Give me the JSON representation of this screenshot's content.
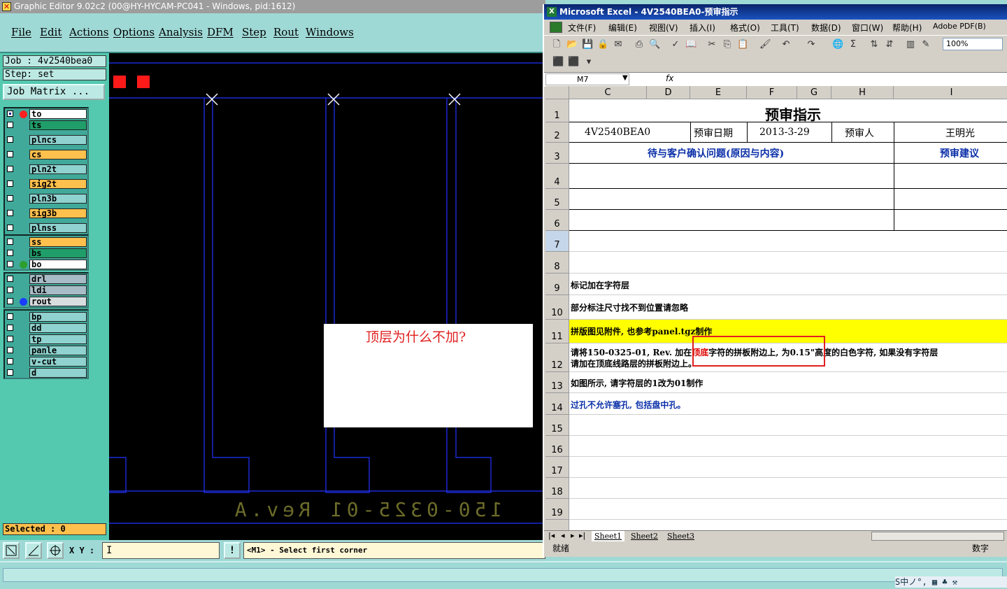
{
  "ge": {
    "title": "Graphic Editor 9.02c2 (00@HY-HYCAM-PC041 - Windows, pid:1612)",
    "menu": [
      "File",
      "Edit",
      "Actions",
      "Options",
      "Analysis",
      "DFM",
      "Step",
      "Rout",
      "Windows"
    ],
    "job_label": "Job : 4v2540bea0",
    "step_label": "Step: set",
    "job_matrix": "Job Matrix ...",
    "layers": [
      {
        "name": "to",
        "color": "#ffffff",
        "dot": "#ff2020",
        "checked": true
      },
      {
        "name": "ts",
        "color": "#1f9e6a",
        "dot": "",
        "checked": false
      },
      {
        "name": "plncs",
        "color": "#8fd2cf",
        "dot": "",
        "checked": false
      },
      {
        "name": "cs",
        "color": "#ffc04d",
        "dot": "",
        "checked": false
      },
      {
        "name": "pln2t",
        "color": "#8fd2cf",
        "dot": "",
        "checked": false
      },
      {
        "name": "sig2t",
        "color": "#ffc04d",
        "dot": "",
        "checked": false
      },
      {
        "name": "pln3b",
        "color": "#8fd2cf",
        "dot": "",
        "checked": false
      },
      {
        "name": "sig3b",
        "color": "#ffc04d",
        "dot": "",
        "checked": false
      },
      {
        "name": "plnss",
        "color": "#8fd2cf",
        "dot": "",
        "checked": false
      },
      {
        "name": "ss",
        "color": "#ffc04d",
        "dot": "",
        "checked": false
      },
      {
        "name": "bs",
        "color": "#1f9e6a",
        "dot": "",
        "checked": false
      },
      {
        "name": "bo",
        "color": "#ffffff",
        "dot": "#2e9e2e",
        "checked": false
      },
      {
        "name": "drl",
        "color": "#a7bcc6",
        "dot": "",
        "checked": false
      },
      {
        "name": "ldi",
        "color": "#a7bcc6",
        "dot": "",
        "checked": false
      },
      {
        "name": "rout",
        "color": "#d8dde0",
        "dot": "#1a3cff",
        "checked": false
      },
      {
        "name": "bp",
        "color": "#8fd2cf",
        "dot": "",
        "checked": false
      },
      {
        "name": "dd",
        "color": "#8fd2cf",
        "dot": "",
        "checked": false
      },
      {
        "name": "tp",
        "color": "#8fd2cf",
        "dot": "",
        "checked": false
      },
      {
        "name": "panle",
        "color": "#8fd2cf",
        "dot": "",
        "checked": false
      },
      {
        "name": "v-cut",
        "color": "#8fd2cf",
        "dot": "",
        "checked": false
      },
      {
        "name": "d",
        "color": "#8fd2cf",
        "dot": "",
        "checked": false
      }
    ],
    "selected": "Selected : 0",
    "xy_label": "X Y :",
    "xy_value": "I",
    "prompt": "<M1> - Select first corner",
    "mirror_text": "150-0325-01 Rev.A",
    "annotation": "顶层为什么不加?"
  },
  "excel": {
    "title": "Microsoft Excel - 4V2540BEA0-预审指示",
    "menu": [
      "文件(F)",
      "编辑(E)",
      "视图(V)",
      "插入(I)",
      "格式(O)",
      "工具(T)",
      "数据(D)",
      "窗口(W)",
      "帮助(H)",
      "Adobe PDF(B)"
    ],
    "zoom": "100%",
    "namebox": "M7",
    "fx": "fx",
    "columns": [
      "C",
      "D",
      "E",
      "F",
      "G",
      "H",
      "I"
    ],
    "rows": [
      "1",
      "2",
      "3",
      "4",
      "5",
      "6",
      "7",
      "8",
      "9",
      "10",
      "11",
      "12",
      "13",
      "14",
      "15",
      "16",
      "17",
      "18",
      "19"
    ],
    "cells": {
      "title": "预审指示",
      "job": "4V2540BEA0",
      "date_label": "预审日期",
      "date": "2013-3-29",
      "reviewer_label": "预审人",
      "reviewer": "王明光",
      "issues_header": "待与客户确认问题(原因与内容)",
      "advice_header": "预审建议",
      "r9": "标记加在字符层",
      "r10": "部分标注尺寸找不到位置请忽略",
      "r11": "拼版图见附件, 也参考panel.tgz制作",
      "r12a_1": "请将150-0325-01, Rev. ",
      "r12a_2": " 加在",
      "r12a_red": "顶底",
      "r12a_3": "字符的拼板附边上, 为0.15\"高度的白色字符, 如果没有字符层",
      "r12b": "请加在顶底线路层的拼板附边上。",
      "r13": "如图所示, 请字符层的1改为01制作",
      "r14": "过孔不允许塞孔, 包括盘中孔。"
    },
    "sheets": [
      "Sheet1",
      "Sheet2",
      "Sheet3"
    ],
    "status_left": "就绪",
    "status_right": "数字"
  },
  "tray": "S中ノ°, ▦ ♣ ⚒"
}
